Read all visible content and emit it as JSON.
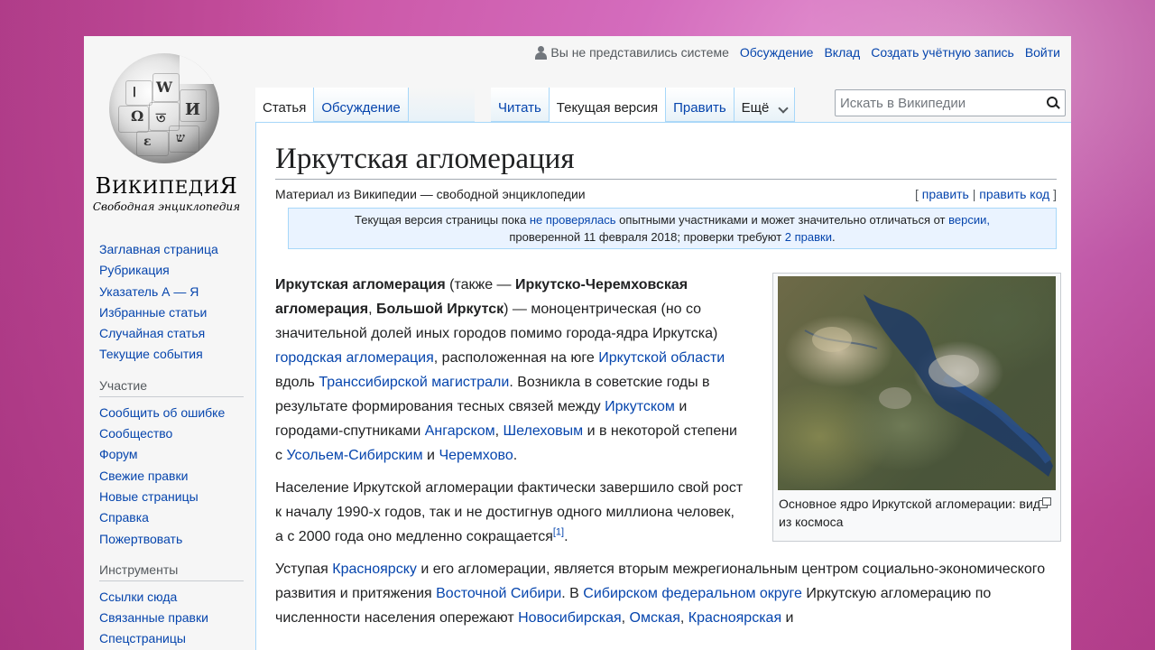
{
  "personal": {
    "anon": "Вы не представились системе",
    "links": [
      "Обсуждение",
      "Вклад",
      "Создать учётную запись",
      "Войти"
    ]
  },
  "logo": {
    "wordmark_1": "В",
    "wordmark_2": "ИКИПЕДИ",
    "wordmark_3": "Я",
    "tagline": "Свободная энциклопедия"
  },
  "sidebar": {
    "nav": [
      "Заглавная страница",
      "Рубрикация",
      "Указатель А — Я",
      "Избранные статьи",
      "Случайная статья",
      "Текущие события"
    ],
    "participation_head": "Участие",
    "participation": [
      "Сообщить об ошибке",
      "Сообщество",
      "Форум",
      "Свежие правки",
      "Новые страницы",
      "Справка",
      "Пожертвовать"
    ],
    "tools_head": "Инструменты",
    "tools": [
      "Ссылки сюда",
      "Связанные правки",
      "Спецстраницы"
    ]
  },
  "tabs": {
    "article": "Статья",
    "talk": "Обсуждение",
    "read": "Читать",
    "current": "Текущая версия",
    "edit": "Править",
    "more": "Ещё"
  },
  "search": {
    "placeholder": "Искать в Википедии"
  },
  "page": {
    "title": "Иркутская агломерация",
    "from": "Материал из Википедии — свободной энциклопедии",
    "edit_open": "[",
    "edit": "править",
    "edit_sep": "|",
    "edit_code": "править код",
    "edit_close": "]"
  },
  "notice": {
    "t1": "Текущая версия страницы пока ",
    "l1": "не проверялась",
    "t2": " опытными участниками и может значительно отличаться от ",
    "l2": "версии,",
    "t3": "проверенной 11 февраля 2018",
    "t4": "; проверки требуют ",
    "l3": "2 правки",
    "t5": "."
  },
  "para1": {
    "b1": "Иркутская агломерация",
    "t1": " (также — ",
    "b2": "Иркутско-Черемховская агломерация",
    "t2": ", ",
    "b3": "Большой Иркутск",
    "t3": ") — моноцентрическая (но со значительной долей иных городов помимо города-ядра Иркутска) ",
    "l1": "городская агломерация",
    "t4": ", расположенная на юге ",
    "l2": "Иркутской области",
    "t5": " вдоль ",
    "l3": "Транссибирской магистрали",
    "t6": ". Возникла в советские годы в результате формирования тесных связей между ",
    "l4": "Иркутском",
    "t7": " и городами-спутниками ",
    "l5": "Ангарском",
    "t8": ", ",
    "l6": "Шелеховым",
    "t9": " и в некоторой степени с ",
    "l7": "Усольем-Сибирским",
    "t10": " и ",
    "l8": "Черемхово",
    "t11": "."
  },
  "para2": {
    "t1": "Население Иркутской агломерации фактически завершило свой рост к началу 1990-х годов, так и не достигнув одного миллиона человек, а с 2000 года оно медленно сокращается",
    "ref": "[1]",
    "t2": "."
  },
  "para3": {
    "t1": "Уступая ",
    "l1": "Красноярску",
    "t2": " и его агломерации, является вторым межрегиональным центром социально-экономического развития и притяжения ",
    "l2": "Восточной Сибири",
    "t3": ". В ",
    "l3": "Сибирском федеральном округе",
    "t4": " Иркутскую агломерацию по численности населения опережают ",
    "l4": "Новосибирская",
    "t5": ", ",
    "l5": "Омская",
    "t6": ", ",
    "l6": "Красноярская",
    "t7": " и"
  },
  "thumb": {
    "caption": "Основное ядро Иркутской агломерации: вид из космоса"
  }
}
